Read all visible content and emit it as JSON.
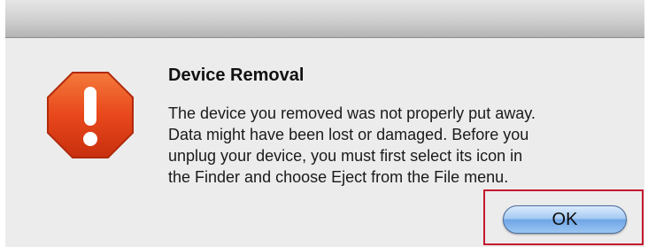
{
  "dialog": {
    "title": "Device Removal",
    "message_lines": [
      "The device you removed was not properly put away.",
      "Data might have been lost or damaged. Before you",
      "unplug your device, you must first select its icon in",
      "the Finder and choose Eject from the File menu."
    ],
    "icon": "alert-stop-icon",
    "ok_label": "OK"
  },
  "colors": {
    "alert_icon": "#e8471c",
    "ok_button": "#8fbdf0",
    "highlight": "#c3192f"
  }
}
